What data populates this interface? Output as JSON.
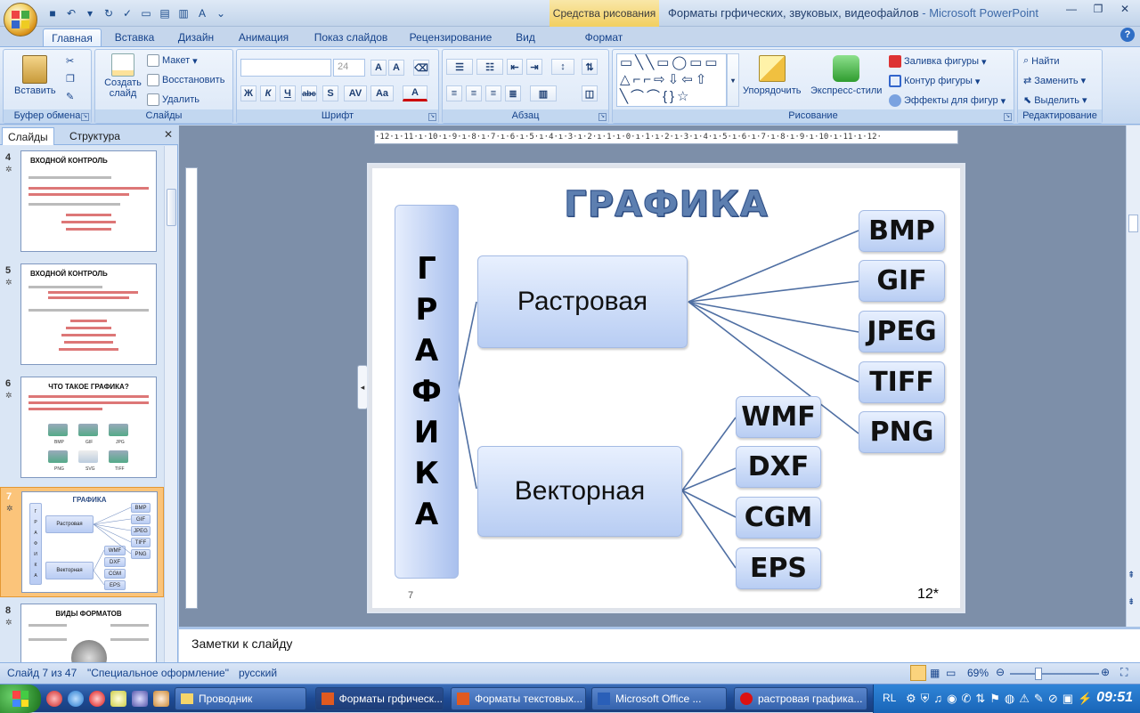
{
  "window": {
    "title": "Форматы грфических, звуковых, видеофайлов",
    "app_suffix": " - Microsoft PowerPoint",
    "contextual_tab_group": "Средства рисования"
  },
  "ribbon_tabs": [
    "Главная",
    "Вставка",
    "Дизайн",
    "Анимация",
    "Показ слайдов",
    "Рецензирование",
    "Вид",
    "Формат"
  ],
  "ribbon": {
    "clipboard": {
      "label": "Буфер обмена",
      "paste": "Вставить"
    },
    "slides": {
      "label": "Слайды",
      "create": "Создать слайд",
      "layout": "Макет",
      "reset": "Восстановить",
      "delete": "Удалить"
    },
    "font": {
      "label": "Шрифт",
      "size": "24",
      "bold": "Ж",
      "italic": "К",
      "underline": "Ч",
      "strike": "abc",
      "shadow": "S"
    },
    "paragraph": {
      "label": "Абзац"
    },
    "drawing": {
      "label": "Рисование",
      "arrange": "Упорядочить",
      "quick_styles": "Экспресс-стили",
      "fill": "Заливка фигуры",
      "outline": "Контур фигуры",
      "effects": "Эффекты для фигур"
    },
    "editing": {
      "label": "Редактирование",
      "find": "Найти",
      "replace": "Заменить",
      "select": "Выделить"
    }
  },
  "pane_tabs": {
    "slides": "Слайды",
    "outline": "Структура"
  },
  "thumbnails": [
    {
      "num": "4",
      "title": "ВХОДНОЙ КОНТРОЛЬ"
    },
    {
      "num": "5",
      "title": "ВХОДНОЙ КОНТРОЛЬ"
    },
    {
      "num": "6",
      "title": "ЧТО ТАКОЕ ГРАФИКА?",
      "captions": [
        "BMP",
        "GIF",
        "JPG",
        "PNG",
        "SVG",
        "TIFF"
      ]
    },
    {
      "num": "7",
      "title": "ГРАФИКА",
      "root": "Г Р А Ф И К А",
      "raster": "Растровая",
      "vector": "Векторная",
      "raster_items": [
        "BMP",
        "GIF",
        "JPEG",
        "TIFF",
        "PNG"
      ],
      "vector_items": [
        "WMF",
        "DXF",
        "CGM",
        "EPS"
      ]
    },
    {
      "num": "8",
      "title": "ВИДЫ ФОРМАТОВ"
    }
  ],
  "ruler_text": "·12·ı·11·ı·10·ı·9·ı·8·ı·7·ı·6·ı·5·ı·4·ı·3·ı·2·ı·1·ı·0·ı·1·ı·2·ı·3·ı·4·ı·5·ı·6·ı·7·ı·8·ı·9·ı·10·ı·11·ı·12·",
  "slide": {
    "title": "ГРАФИКА",
    "root_letters": [
      "Г",
      "Р",
      "А",
      "Ф",
      "И",
      "К",
      "А"
    ],
    "raster": "Растровая",
    "vector": "Векторная",
    "raster_items": [
      "BMP",
      "GIF",
      "JPEG",
      "TIFF",
      "PNG"
    ],
    "vector_items": [
      "WMF",
      "DXF",
      "CGM",
      "EPS"
    ],
    "number_left": "7",
    "number_right": "12*"
  },
  "notes_placeholder": "Заметки к слайду",
  "status": {
    "slide": "Слайд 7 из 47",
    "theme": "\"Специальное оформление\"",
    "language": "русский",
    "zoom": "69%"
  },
  "taskbar": {
    "buttons": [
      "Проводник",
      "Форматы грфическ...",
      "Форматы текстовых...",
      "Microsoft Office ...",
      "растровая графика..."
    ],
    "lang": "RL",
    "clock": "09:51"
  },
  "colors": {
    "accent": "#15428b",
    "slide_box": "#b8cdf3",
    "title": "#5d7fb0",
    "selected_thumb": "#fbc47a"
  }
}
